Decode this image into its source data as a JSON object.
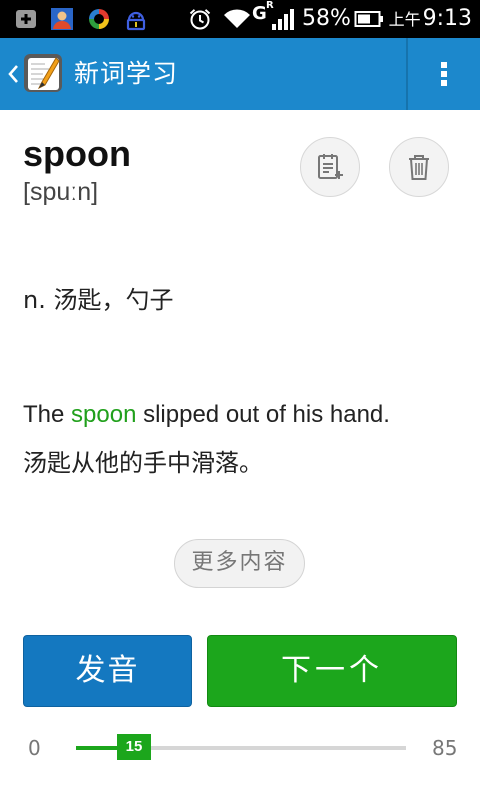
{
  "status_bar": {
    "battery_percent": "58%",
    "ampm": "上午",
    "time": "9:13",
    "network_label": "G",
    "roaming_label": "R",
    "icons": [
      "add-box-icon",
      "contacts-icon",
      "sync-app-icon",
      "usb-debug-icon",
      "alarm-icon",
      "wifi-icon",
      "signal-icon",
      "battery-icon"
    ]
  },
  "action_bar": {
    "title": "新词学习",
    "icons": [
      "back-chevron-icon",
      "vocabulary-app-icon",
      "overflow-menu-icon"
    ],
    "color": "#1c88cc"
  },
  "word": {
    "headword": "spoon",
    "phonetic": "[spuːn]",
    "definition": "n. 汤匙，勺子",
    "example_before": "The ",
    "example_highlight": "spoon",
    "example_after": " slipped out of his hand.",
    "example_translation": "汤匙从他的手中滑落。",
    "highlight_color": "#21a01c",
    "action_icons": [
      "add-to-notebook-icon",
      "trash-icon"
    ]
  },
  "buttons": {
    "more": "更多内容",
    "pronounce": "发音",
    "next": "下一个",
    "pronounce_color": "#1478c0",
    "next_color": "#1ca61c"
  },
  "progress": {
    "min": "0",
    "max": "85",
    "current": "15",
    "min_value": 0,
    "max_value": 85,
    "current_value": 15
  }
}
